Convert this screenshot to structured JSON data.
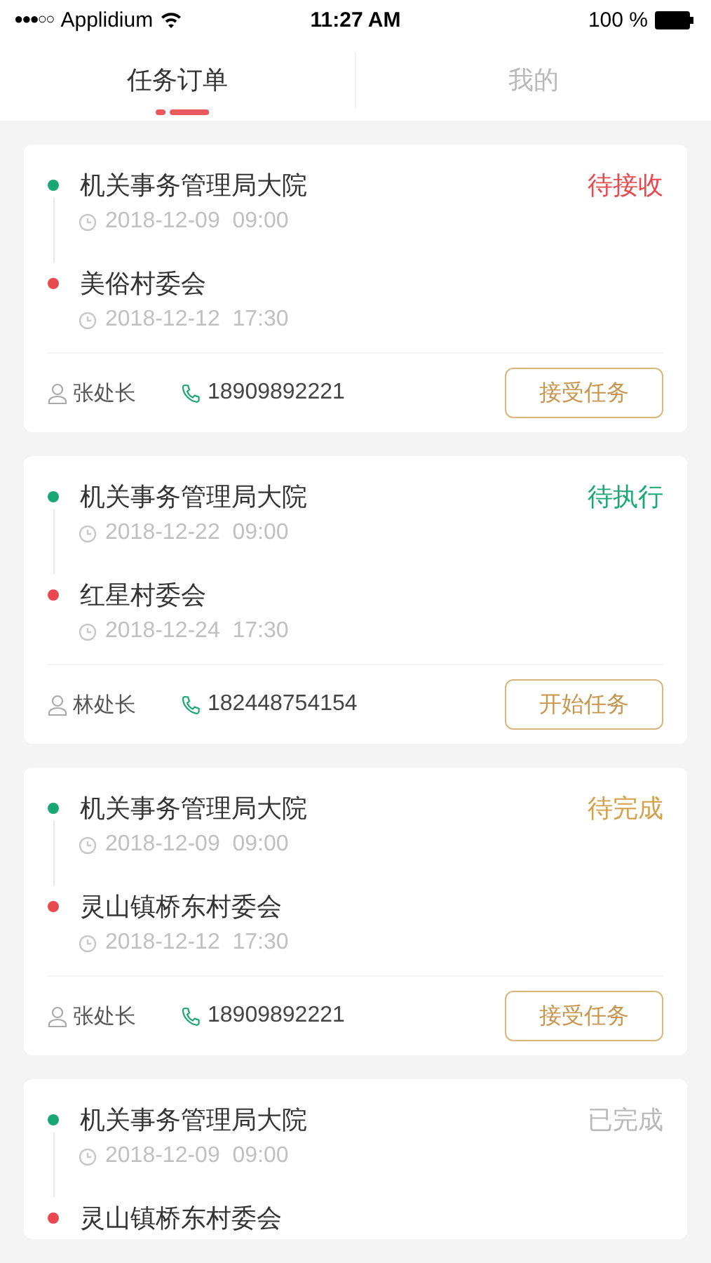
{
  "status_bar": {
    "signal": "●●●○○",
    "carrier": "Applidium",
    "time": "11:27 AM",
    "battery": "100 %"
  },
  "tabs": [
    {
      "label": "任务订单",
      "selected": true
    },
    {
      "label": "我的",
      "selected": false
    }
  ],
  "orders": [
    {
      "from": {
        "name": "机关事务管理局大院",
        "time": "2018-12-09  09:00"
      },
      "to": {
        "name": "美俗村委会",
        "time": "2018-12-12  17:30"
      },
      "status": {
        "label": "待接收",
        "kind": "pending"
      },
      "contact": "张处长",
      "phone": "18909892221",
      "action": "接受任务"
    },
    {
      "from": {
        "name": "机关事务管理局大院",
        "time": "2018-12-22  09:00"
      },
      "to": {
        "name": "红星村委会",
        "time": "2018-12-24  17:30"
      },
      "status": {
        "label": "待执行",
        "kind": "executing"
      },
      "contact": "林处长",
      "phone": "182448754154",
      "action": "开始任务"
    },
    {
      "from": {
        "name": "机关事务管理局大院",
        "time": "2018-12-09  09:00"
      },
      "to": {
        "name": "灵山镇桥东村委会",
        "time": "2018-12-12  17:30"
      },
      "status": {
        "label": "待完成",
        "kind": "finishing"
      },
      "contact": "张处长",
      "phone": "18909892221",
      "action": "接受任务"
    },
    {
      "from": {
        "name": "机关事务管理局大院",
        "time": "2018-12-09  09:00"
      },
      "to": {
        "name": "灵山镇桥东村委会"
      },
      "status": {
        "label": "已完成",
        "kind": "done"
      }
    }
  ]
}
